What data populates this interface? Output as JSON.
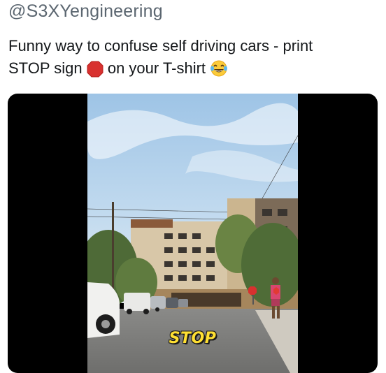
{
  "tweet": {
    "handle": "@S3XYengineering",
    "text_line1": "Funny way to confuse self driving cars - print",
    "text_line2_a": "STOP sign",
    "text_line2_b": "on your T-shirt"
  },
  "icons": {
    "stop_sign": "stop-sign-emoji",
    "laughing": "face-with-tears-of-joy-emoji"
  },
  "media": {
    "caption": "STOP"
  },
  "colors": {
    "handle": "#5b6670",
    "text": "#14171a",
    "caption": "#ffe033",
    "stop_red": "#d8312f"
  }
}
